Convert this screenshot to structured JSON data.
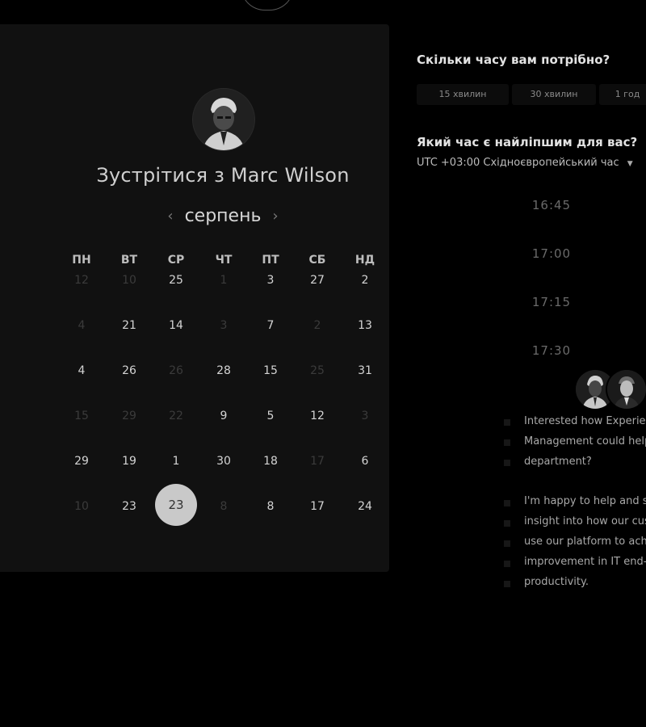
{
  "scheduler": {
    "title_prefix": "Зустрітися з",
    "host_name": "Marc Wilson",
    "month": "серпень",
    "weekdays": [
      "ПН",
      "ВТ",
      "СР",
      "ЧТ",
      "ПТ",
      "СБ",
      "НД"
    ],
    "weeks": [
      [
        {
          "d": "12",
          "on": false
        },
        {
          "d": "10",
          "on": false
        },
        {
          "d": "25",
          "on": true
        },
        {
          "d": "1",
          "on": false
        },
        {
          "d": "3",
          "on": true
        },
        {
          "d": "27",
          "on": true
        },
        {
          "d": "2",
          "on": true
        }
      ],
      [
        {
          "d": "4",
          "on": false
        },
        {
          "d": "21",
          "on": true
        },
        {
          "d": "14",
          "on": true
        },
        {
          "d": "3",
          "on": false
        },
        {
          "d": "7",
          "on": true
        },
        {
          "d": "2",
          "on": false
        },
        {
          "d": "13",
          "on": true
        }
      ],
      [
        {
          "d": "4",
          "on": true
        },
        {
          "d": "26",
          "on": true
        },
        {
          "d": "26",
          "on": false
        },
        {
          "d": "28",
          "on": true
        },
        {
          "d": "15",
          "on": true
        },
        {
          "d": "25",
          "on": false
        },
        {
          "d": "31",
          "on": true
        }
      ],
      [
        {
          "d": "15",
          "on": false
        },
        {
          "d": "29",
          "on": false
        },
        {
          "d": "22",
          "on": false
        },
        {
          "d": "9",
          "on": true
        },
        {
          "d": "5",
          "on": true
        },
        {
          "d": "12",
          "on": true
        },
        {
          "d": "3",
          "on": false
        }
      ],
      [
        {
          "d": "29",
          "on": true
        },
        {
          "d": "19",
          "on": true
        },
        {
          "d": "1",
          "on": true
        },
        {
          "d": "30",
          "on": true
        },
        {
          "d": "18",
          "on": true
        },
        {
          "d": "17",
          "on": false
        },
        {
          "d": "6",
          "on": true
        }
      ],
      [
        {
          "d": "10",
          "on": false
        },
        {
          "d": "23",
          "on": true
        },
        {
          "d": "23",
          "on": true,
          "selected": true
        },
        {
          "d": "8",
          "on": false
        },
        {
          "d": "8",
          "on": true
        },
        {
          "d": "17",
          "on": true
        },
        {
          "d": "24",
          "on": true
        }
      ]
    ]
  },
  "duration": {
    "title": "Скільки часу вам потрібно?",
    "options": [
      "15 хвилин",
      "30 хвилин",
      "1 год"
    ]
  },
  "time": {
    "title": "Який час є найліпшим для вас?",
    "timezone": "UTC +03:00 Східноєвропейський час",
    "slots": [
      "16:45",
      "17:00",
      "17:15",
      "17:30"
    ]
  },
  "message": {
    "lines": [
      "Interested how Experien",
      "Management could help",
      "department?",
      "",
      "I'm happy to help and s",
      "insight into how our cus",
      "use our platform to achi",
      "improvement in IT end-",
      "productivity."
    ]
  },
  "colors": {
    "background": "#000000",
    "card": "#111111",
    "selected_day": "#c9c9c9"
  }
}
